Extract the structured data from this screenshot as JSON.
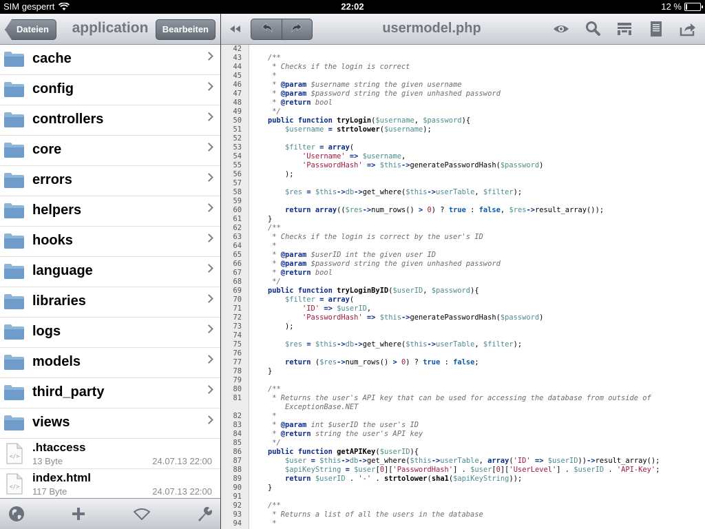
{
  "status": {
    "carrier": "SIM gesperrt",
    "time": "22:02",
    "battery": "12 %",
    "battery_level": 0.12
  },
  "files_nav": {
    "back_label": "Dateien",
    "title": "application",
    "edit_label": "Bearbeiten"
  },
  "folders": [
    "cache",
    "config",
    "controllers",
    "core",
    "errors",
    "helpers",
    "hooks",
    "language",
    "libraries",
    "logs",
    "models",
    "third_party",
    "views"
  ],
  "files": [
    {
      "name": ".htaccess",
      "size": "13 Byte",
      "date": "24.07.13 22:00"
    },
    {
      "name": "index.html",
      "size": "117 Byte",
      "date": "24.07.13 22:00"
    }
  ],
  "toolbar_icons": [
    "globe-icon",
    "plus-icon",
    "wifi-icon",
    "wrench-icon"
  ],
  "editor_nav": {
    "title": "usermodel.php",
    "icons": [
      "rewind-icon",
      "undo-icon",
      "redo-icon",
      "eye-icon",
      "search-icon",
      "layout-icon",
      "document-icon",
      "share-icon"
    ]
  },
  "code_lines": [
    {
      "n": "42",
      "h": ""
    },
    {
      "n": "43",
      "h": "<span class='c'>/**</span>"
    },
    {
      "n": "44",
      "h": "<span class='c'> * Checks if the login is correct</span>"
    },
    {
      "n": "45",
      "h": "<span class='c'> *</span>"
    },
    {
      "n": "46",
      "h": "<span class='c'> * <span class='ck'>@param</span> $username string the given username</span>"
    },
    {
      "n": "47",
      "h": "<span class='c'> * <span class='ck'>@param</span> $password string the given unhashed password</span>"
    },
    {
      "n": "48",
      "h": "<span class='c'> * <span class='ck'>@return</span> bool</span>"
    },
    {
      "n": "49",
      "h": "<span class='c'> */</span>"
    },
    {
      "n": "50",
      "h": "<span class='k'>public function</span> <span class='f'>tryLogin</span>(<span class='v'>$username</span>, <span class='v'>$password</span>){"
    },
    {
      "n": "51",
      "h": "    <span class='v'>$username</span> <span class='k'>=</span> <span class='f'>strtolower</span>(<span class='v'>$username</span>);"
    },
    {
      "n": "52",
      "h": ""
    },
    {
      "n": "53",
      "h": "    <span class='v'>$filter</span> <span class='k'>= array</span>("
    },
    {
      "n": "54",
      "h": "        <span class='s'>'Username'</span> <span class='k'>=></span> <span class='v'>$username</span>,"
    },
    {
      "n": "55",
      "h": "        <span class='s'>'PasswordHash'</span> <span class='k'>=></span> <span class='v'>$this</span><span class='k'>-></span>generatePasswordHash(<span class='v'>$password</span>)"
    },
    {
      "n": "56",
      "h": "    );"
    },
    {
      "n": "57",
      "h": ""
    },
    {
      "n": "58",
      "h": "    <span class='v'>$res</span> <span class='k'>=</span> <span class='v'>$this</span><span class='k'>-></span><span class='v'>db</span><span class='k'>-></span>get_where(<span class='v'>$this</span><span class='k'>-></span><span class='v'>userTable</span>, <span class='v'>$filter</span>);"
    },
    {
      "n": "59",
      "h": ""
    },
    {
      "n": "60",
      "h": "    <span class='k'>return array</span>((<span class='v'>$res</span><span class='k'>-></span>num_rows() <span class='k'>></span> <span class='n'>0</span>) ? <span class='t'>true</span> : <span class='t'>false</span>, <span class='v'>$res</span><span class='k'>-></span>result_array());"
    },
    {
      "n": "61",
      "h": "}"
    },
    {
      "n": "62",
      "h": "<span class='c'>/**</span>"
    },
    {
      "n": "63",
      "h": "<span class='c'> * Checks if the login is correct by the user's ID</span>"
    },
    {
      "n": "64",
      "h": "<span class='c'> *</span>"
    },
    {
      "n": "65",
      "h": "<span class='c'> * <span class='ck'>@param</span> $userID int the given user ID</span>"
    },
    {
      "n": "66",
      "h": "<span class='c'> * <span class='ck'>@param</span> $password string the given unhashed password</span>"
    },
    {
      "n": "67",
      "h": "<span class='c'> * <span class='ck'>@return</span> bool</span>"
    },
    {
      "n": "68",
      "h": "<span class='c'> */</span>"
    },
    {
      "n": "69",
      "h": "<span class='k'>public function</span> <span class='f'>tryLoginByID</span>(<span class='v'>$userID</span>, <span class='v'>$password</span>){"
    },
    {
      "n": "70",
      "h": "    <span class='v'>$filter</span> <span class='k'>= array</span>("
    },
    {
      "n": "71",
      "h": "        <span class='s'>'ID'</span> <span class='k'>=></span> <span class='v'>$userID</span>,"
    },
    {
      "n": "72",
      "h": "        <span class='s'>'PasswordHash'</span> <span class='k'>=></span> <span class='v'>$this</span><span class='k'>-></span>generatePasswordHash(<span class='v'>$password</span>)"
    },
    {
      "n": "73",
      "h": "    );"
    },
    {
      "n": "74",
      "h": ""
    },
    {
      "n": "75",
      "h": "    <span class='v'>$res</span> <span class='k'>=</span> <span class='v'>$this</span><span class='k'>-></span><span class='v'>db</span><span class='k'>-></span>get_where(<span class='v'>$this</span><span class='k'>-></span><span class='v'>userTable</span>, <span class='v'>$filter</span>);"
    },
    {
      "n": "76",
      "h": ""
    },
    {
      "n": "77",
      "h": "    <span class='k'>return</span> (<span class='v'>$res</span><span class='k'>-></span>num_rows() <span class='k'>></span> <span class='n'>0</span>) ? <span class='t'>true</span> : <span class='t'>false</span>;"
    },
    {
      "n": "78",
      "h": "}"
    },
    {
      "n": "79",
      "h": ""
    },
    {
      "n": "80",
      "h": "<span class='c'>/**</span>"
    },
    {
      "n": "81",
      "h": "<span class='c'> * Returns the user's API key that can be used for accessing the database from outside of</span>"
    },
    {
      "n": "",
      "h": "<span class='c'>    ExceptionBase.NET</span>"
    },
    {
      "n": "82",
      "h": "<span class='c'> *</span>"
    },
    {
      "n": "83",
      "h": "<span class='c'> * <span class='ck'>@param</span> int $userID the user's ID</span>"
    },
    {
      "n": "84",
      "h": "<span class='c'> * <span class='ck'>@return</span> string the user's API key</span>"
    },
    {
      "n": "85",
      "h": "<span class='c'> */</span>"
    },
    {
      "n": "86",
      "h": "<span class='k'>public function</span> <span class='f'>getAPIKey</span>(<span class='v'>$userID</span>){"
    },
    {
      "n": "87",
      "h": "    <span class='v'>$user</span> <span class='k'>=</span> <span class='v'>$this</span><span class='k'>-></span><span class='v'>db</span><span class='k'>-></span>get_where(<span class='v'>$this</span><span class='k'>-></span><span class='v'>userTable</span>, <span class='k'>array</span>(<span class='s'>'ID'</span> <span class='k'>=></span> <span class='v'>$userID</span>))<span class='k'>-></span>result_array();"
    },
    {
      "n": "88",
      "h": "    <span class='v'>$apiKeyString</span> <span class='k'>=</span> <span class='v'>$user</span>[<span class='n'>0</span>][<span class='s'>'PasswordHash'</span>] . <span class='v'>$user</span>[<span class='n'>0</span>][<span class='s'>'UserLevel'</span>] . <span class='v'>$userID</span> . <span class='s'>'API-Key'</span>;"
    },
    {
      "n": "89",
      "h": "    <span class='k'>return</span> <span class='v'>$userID</span> . <span class='s'>'-'</span> . <span class='f'>strtolower</span>(<span class='f'>sha1</span>(<span class='v'>$apiKeyString</span>));"
    },
    {
      "n": "90",
      "h": "}"
    },
    {
      "n": "91",
      "h": ""
    },
    {
      "n": "92",
      "h": "<span class='c'>/**</span>"
    },
    {
      "n": "93",
      "h": "<span class='c'> * Returns a list of all the users in the database</span>"
    },
    {
      "n": "94",
      "h": "<span class='c'> *</span>"
    }
  ]
}
